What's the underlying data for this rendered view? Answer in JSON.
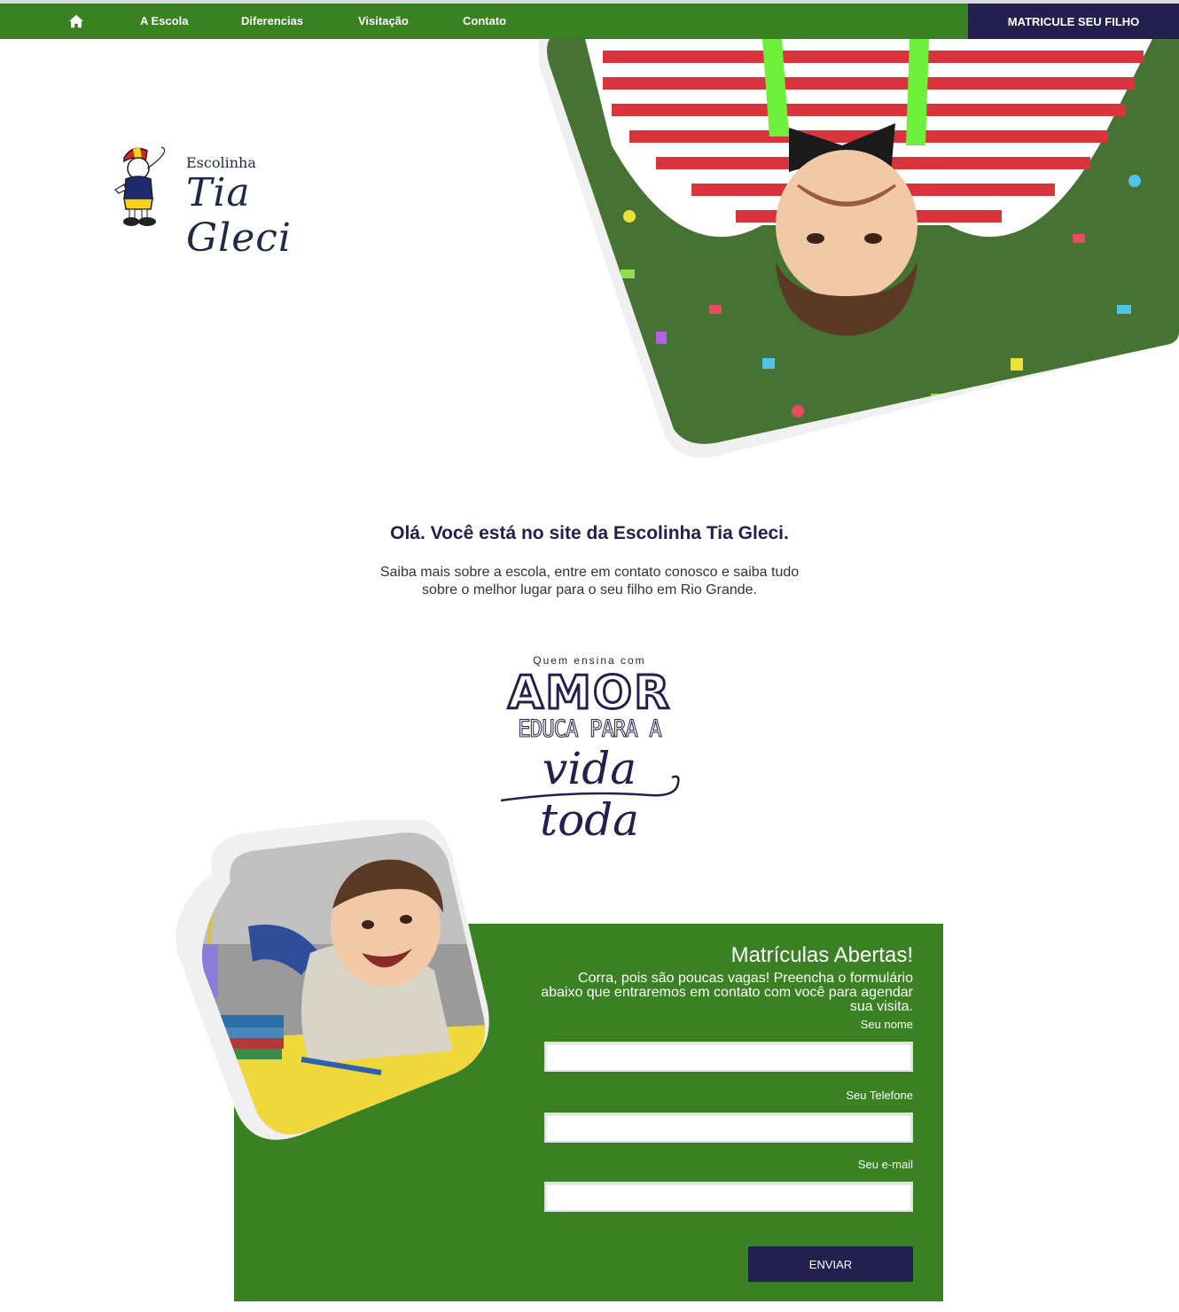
{
  "nav": {
    "home_icon": "home-icon",
    "items": [
      {
        "label": "A Escola"
      },
      {
        "label": "Diferencias"
      },
      {
        "label": "Visitação"
      },
      {
        "label": "Contato"
      }
    ],
    "cta_label": "MATRICULE SEU FILHO"
  },
  "logo": {
    "line1": "Escolinha",
    "line2": "Tia Gleci"
  },
  "intro": {
    "title": "Olá. Você está no site da Escolinha Tia Gleci.",
    "text": "Saiba mais sobre a escola, entre em contato conosco e saiba tudo sobre o melhor lugar para o seu filho em Rio Grande."
  },
  "slogan": {
    "line1": "Quem ensina com",
    "line2": "AMOR",
    "line3": "EDUCA PARA A",
    "line4": "vida toda"
  },
  "form": {
    "title": "Matrículas Abertas!",
    "description": "Corra, pois são poucas vagas! Preencha o formulário abaixo que entraremos em contato com você para agendar sua visita.",
    "fields": [
      {
        "label": "Seu nome",
        "value": ""
      },
      {
        "label": "Seu Telefone",
        "value": ""
      },
      {
        "label": "Seu e-mail",
        "value": ""
      }
    ],
    "submit_label": "ENVIAR"
  },
  "colors": {
    "green": "#398123",
    "navy": "#23204f"
  }
}
